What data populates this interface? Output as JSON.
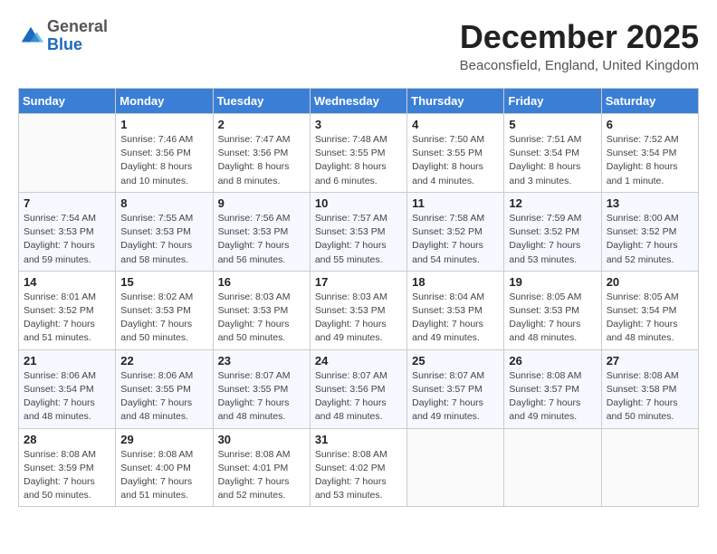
{
  "header": {
    "logo_general": "General",
    "logo_blue": "Blue",
    "month_title": "December 2025",
    "subtitle": "Beaconsfield, England, United Kingdom"
  },
  "days_of_week": [
    "Sunday",
    "Monday",
    "Tuesday",
    "Wednesday",
    "Thursday",
    "Friday",
    "Saturday"
  ],
  "weeks": [
    [
      {
        "day": "",
        "info": ""
      },
      {
        "day": "1",
        "info": "Sunrise: 7:46 AM\nSunset: 3:56 PM\nDaylight: 8 hours\nand 10 minutes."
      },
      {
        "day": "2",
        "info": "Sunrise: 7:47 AM\nSunset: 3:56 PM\nDaylight: 8 hours\nand 8 minutes."
      },
      {
        "day": "3",
        "info": "Sunrise: 7:48 AM\nSunset: 3:55 PM\nDaylight: 8 hours\nand 6 minutes."
      },
      {
        "day": "4",
        "info": "Sunrise: 7:50 AM\nSunset: 3:55 PM\nDaylight: 8 hours\nand 4 minutes."
      },
      {
        "day": "5",
        "info": "Sunrise: 7:51 AM\nSunset: 3:54 PM\nDaylight: 8 hours\nand 3 minutes."
      },
      {
        "day": "6",
        "info": "Sunrise: 7:52 AM\nSunset: 3:54 PM\nDaylight: 8 hours\nand 1 minute."
      }
    ],
    [
      {
        "day": "7",
        "info": "Sunrise: 7:54 AM\nSunset: 3:53 PM\nDaylight: 7 hours\nand 59 minutes."
      },
      {
        "day": "8",
        "info": "Sunrise: 7:55 AM\nSunset: 3:53 PM\nDaylight: 7 hours\nand 58 minutes."
      },
      {
        "day": "9",
        "info": "Sunrise: 7:56 AM\nSunset: 3:53 PM\nDaylight: 7 hours\nand 56 minutes."
      },
      {
        "day": "10",
        "info": "Sunrise: 7:57 AM\nSunset: 3:53 PM\nDaylight: 7 hours\nand 55 minutes."
      },
      {
        "day": "11",
        "info": "Sunrise: 7:58 AM\nSunset: 3:52 PM\nDaylight: 7 hours\nand 54 minutes."
      },
      {
        "day": "12",
        "info": "Sunrise: 7:59 AM\nSunset: 3:52 PM\nDaylight: 7 hours\nand 53 minutes."
      },
      {
        "day": "13",
        "info": "Sunrise: 8:00 AM\nSunset: 3:52 PM\nDaylight: 7 hours\nand 52 minutes."
      }
    ],
    [
      {
        "day": "14",
        "info": "Sunrise: 8:01 AM\nSunset: 3:52 PM\nDaylight: 7 hours\nand 51 minutes."
      },
      {
        "day": "15",
        "info": "Sunrise: 8:02 AM\nSunset: 3:53 PM\nDaylight: 7 hours\nand 50 minutes."
      },
      {
        "day": "16",
        "info": "Sunrise: 8:03 AM\nSunset: 3:53 PM\nDaylight: 7 hours\nand 50 minutes."
      },
      {
        "day": "17",
        "info": "Sunrise: 8:03 AM\nSunset: 3:53 PM\nDaylight: 7 hours\nand 49 minutes."
      },
      {
        "day": "18",
        "info": "Sunrise: 8:04 AM\nSunset: 3:53 PM\nDaylight: 7 hours\nand 49 minutes."
      },
      {
        "day": "19",
        "info": "Sunrise: 8:05 AM\nSunset: 3:53 PM\nDaylight: 7 hours\nand 48 minutes."
      },
      {
        "day": "20",
        "info": "Sunrise: 8:05 AM\nSunset: 3:54 PM\nDaylight: 7 hours\nand 48 minutes."
      }
    ],
    [
      {
        "day": "21",
        "info": "Sunrise: 8:06 AM\nSunset: 3:54 PM\nDaylight: 7 hours\nand 48 minutes."
      },
      {
        "day": "22",
        "info": "Sunrise: 8:06 AM\nSunset: 3:55 PM\nDaylight: 7 hours\nand 48 minutes."
      },
      {
        "day": "23",
        "info": "Sunrise: 8:07 AM\nSunset: 3:55 PM\nDaylight: 7 hours\nand 48 minutes."
      },
      {
        "day": "24",
        "info": "Sunrise: 8:07 AM\nSunset: 3:56 PM\nDaylight: 7 hours\nand 48 minutes."
      },
      {
        "day": "25",
        "info": "Sunrise: 8:07 AM\nSunset: 3:57 PM\nDaylight: 7 hours\nand 49 minutes."
      },
      {
        "day": "26",
        "info": "Sunrise: 8:08 AM\nSunset: 3:57 PM\nDaylight: 7 hours\nand 49 minutes."
      },
      {
        "day": "27",
        "info": "Sunrise: 8:08 AM\nSunset: 3:58 PM\nDaylight: 7 hours\nand 50 minutes."
      }
    ],
    [
      {
        "day": "28",
        "info": "Sunrise: 8:08 AM\nSunset: 3:59 PM\nDaylight: 7 hours\nand 50 minutes."
      },
      {
        "day": "29",
        "info": "Sunrise: 8:08 AM\nSunset: 4:00 PM\nDaylight: 7 hours\nand 51 minutes."
      },
      {
        "day": "30",
        "info": "Sunrise: 8:08 AM\nSunset: 4:01 PM\nDaylight: 7 hours\nand 52 minutes."
      },
      {
        "day": "31",
        "info": "Sunrise: 8:08 AM\nSunset: 4:02 PM\nDaylight: 7 hours\nand 53 minutes."
      },
      {
        "day": "",
        "info": ""
      },
      {
        "day": "",
        "info": ""
      },
      {
        "day": "",
        "info": ""
      }
    ]
  ]
}
